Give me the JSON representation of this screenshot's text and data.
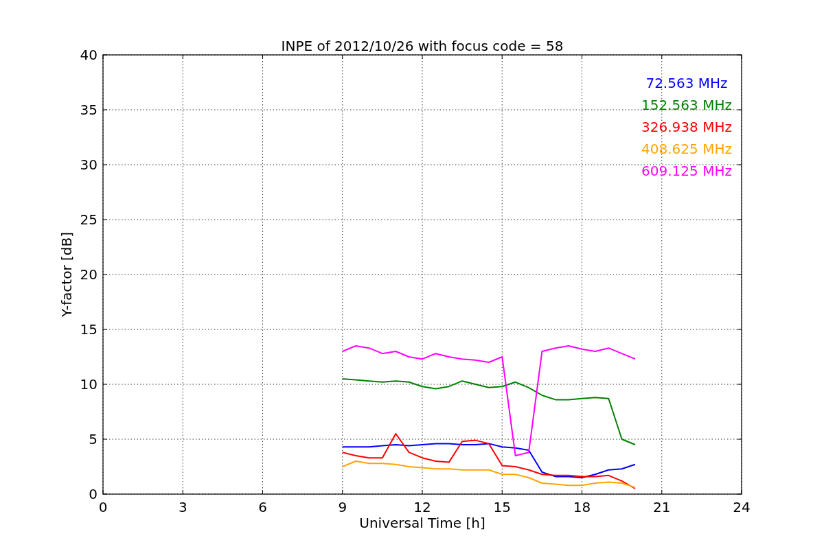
{
  "figure": {
    "chart_data": {
      "type": "line",
      "title": "INPE of 2012/10/26 with focus code = 58",
      "xlabel": "Universal Time [h]",
      "ylabel": "Y-factor [dB]",
      "x": [
        9,
        9.5,
        10,
        10.5,
        11,
        11.5,
        12,
        12.5,
        13,
        13.5,
        14,
        14.5,
        15,
        15.5,
        16,
        16.5,
        17,
        17.5,
        18,
        18.5,
        19,
        19.5,
        20
      ],
      "series": [
        {
          "name": "72.563 MHz",
          "color": "#0000ff",
          "values": [
            4.3,
            4.3,
            4.3,
            4.4,
            4.5,
            4.4,
            4.5,
            4.6,
            4.6,
            4.5,
            4.5,
            4.6,
            4.3,
            4.2,
            4.0,
            2.0,
            1.6,
            1.6,
            1.5,
            1.8,
            2.2,
            2.3,
            2.7
          ]
        },
        {
          "name": "152.563 MHz",
          "color": "#008000",
          "values": [
            10.5,
            10.4,
            10.3,
            10.2,
            10.3,
            10.2,
            9.8,
            9.6,
            9.8,
            10.3,
            10.0,
            9.7,
            9.8,
            10.2,
            9.7,
            9.0,
            8.6,
            8.6,
            8.7,
            8.8,
            8.7,
            5.0,
            4.5
          ]
        },
        {
          "name": "326.938 MHz",
          "color": "#ff0000",
          "values": [
            3.8,
            3.5,
            3.3,
            3.3,
            5.5,
            3.8,
            3.3,
            3.0,
            2.9,
            4.8,
            4.9,
            4.6,
            2.6,
            2.5,
            2.2,
            1.8,
            1.7,
            1.7,
            1.6,
            1.6,
            1.7,
            1.2,
            0.5
          ]
        },
        {
          "name": "408.625 MHz",
          "color": "#ffa500",
          "values": [
            2.5,
            3.0,
            2.8,
            2.8,
            2.7,
            2.5,
            2.4,
            2.3,
            2.3,
            2.2,
            2.2,
            2.2,
            1.8,
            1.8,
            1.5,
            1.0,
            0.9,
            0.8,
            0.8,
            1.0,
            1.1,
            1.0,
            0.6
          ]
        },
        {
          "name": "609.125 MHz",
          "color": "#ff00ff",
          "values": [
            13.0,
            13.5,
            13.3,
            12.8,
            13.0,
            12.5,
            12.3,
            12.8,
            12.5,
            12.3,
            12.2,
            12.0,
            12.5,
            3.5,
            3.8,
            13.0,
            13.3,
            13.5,
            13.2,
            13.0,
            13.3,
            12.8,
            12.3
          ]
        }
      ],
      "xlim": [
        0,
        24
      ],
      "ylim": [
        0,
        40
      ],
      "xticks": [
        0,
        3,
        6,
        9,
        12,
        15,
        18,
        21,
        24
      ],
      "yticks": [
        0,
        5,
        10,
        15,
        20,
        25,
        30,
        35,
        40
      ],
      "grid": true
    }
  }
}
